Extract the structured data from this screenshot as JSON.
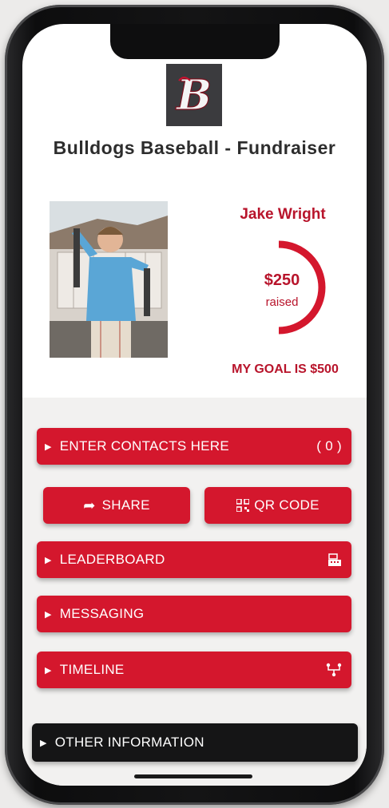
{
  "header": {
    "logo_letter": "B",
    "title": "Bulldogs Baseball - Fundraiser"
  },
  "profile": {
    "name": "Jake Wright",
    "raised_amount": "$250",
    "raised_label": "raised",
    "goal_text": "MY GOAL IS $500",
    "progress_fraction": 0.5
  },
  "actions": {
    "enter_contacts": {
      "label": "ENTER CONTACTS HERE",
      "count": "( 0 )"
    },
    "share": {
      "label": "SHARE"
    },
    "qr_code": {
      "label": "QR CODE"
    },
    "leaderboard": {
      "label": "LEADERBOARD"
    },
    "messaging": {
      "label": "MESSAGING"
    },
    "timeline": {
      "label": "TIMELINE"
    },
    "other_info": {
      "label": "OTHER INFORMATION"
    }
  },
  "icons": {
    "share": "share-arrow-icon",
    "qr": "qr-code-icon",
    "leaderboard": "register-icon",
    "timeline": "network-icon"
  },
  "colors": {
    "brand_red": "#d4172d",
    "text_red": "#b8142b",
    "dark_button": "#151516"
  }
}
